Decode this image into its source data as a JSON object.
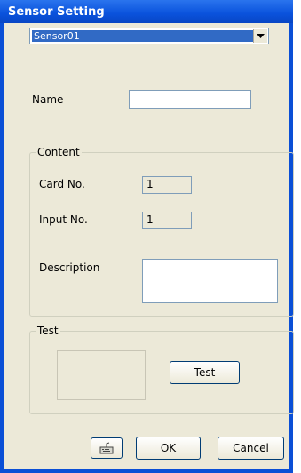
{
  "window": {
    "title": "Sensor Setting"
  },
  "sensor_select": {
    "value": "Sensor01"
  },
  "name": {
    "label": "Name",
    "value": ""
  },
  "content": {
    "group_label": "Content",
    "card_label": "Card No.",
    "card_value": "1",
    "input_label": "Input No.",
    "input_value": "1",
    "description_label": "Description",
    "description_value": ""
  },
  "test": {
    "group_label": "Test",
    "button_label": "Test"
  },
  "footer": {
    "ok_label": "OK",
    "cancel_label": "Cancel"
  },
  "colors": {
    "title_bar": "#0a52dc",
    "dialog_bg": "#ece9d8",
    "selection": "#316ac5"
  },
  "icons": {
    "footer_icon": "keyboard-icon",
    "dropdown": "chevron-down-icon"
  }
}
